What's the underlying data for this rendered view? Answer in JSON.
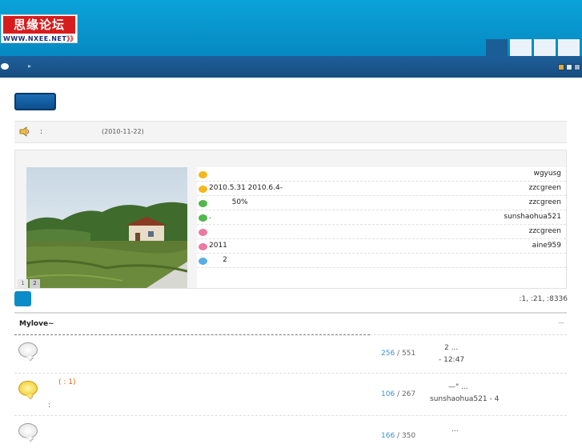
{
  "header": {
    "logo_text": "思缘论坛",
    "logo_url_main": "WWW.NXEE.NET",
    "logo_url_arrows": "》》"
  },
  "announcement": {
    "colon": ":",
    "date": "(2010-11-22)"
  },
  "slideshow": {
    "pages": [
      "1",
      "2"
    ],
    "active_page": "2"
  },
  "threads": [
    {
      "title": "",
      "author": "wgyusg",
      "color": "#f4b81e"
    },
    {
      "title": "2010.5.31 2010.6.4-",
      "author": "zzcgreen",
      "color": "#f4b81e"
    },
    {
      "title": "          50%",
      "author": "zzcgreen",
      "color": "#4fb84c"
    },
    {
      "title": ".",
      "author": "sunshaohua521",
      "color": "#4fb84c"
    },
    {
      "title": "",
      "author": "zzcgreen",
      "color": "#ec7aa0"
    },
    {
      "title": "2011",
      "author": "aine959",
      "color": "#ec7aa0"
    },
    {
      "title": "      2",
      "author": "",
      "color": "#5aaee8"
    }
  ],
  "stats": ":1,  :21,  :8336",
  "forum": {
    "title": "Mylove~",
    "collapse": "—",
    "rows": [
      {
        "icon": "grey",
        "extra": "",
        "extra2": "",
        "topics": "256",
        "posts": "551",
        "last_line1": "2   ...",
        "last_line2": "-  12:47"
      },
      {
        "icon": "yellow",
        "extra": "( : 1)",
        "extra2": ":",
        "topics": "106",
        "posts": "267",
        "last_line1": "—\"  ...",
        "last_line2": "sunshaohua521 - 4"
      },
      {
        "icon": "grey",
        "extra": "",
        "extra2": "",
        "topics": "166",
        "posts": "350",
        "last_line1": "...",
        "last_line2": ""
      }
    ]
  },
  "colors": {
    "header_blue": "#0aa3d8",
    "nav_blue": "#1f5f9a",
    "swatch_orange": "#e6a73a",
    "swatch_light": "#dde7ef",
    "swatch_grey": "#9fb3c4"
  }
}
